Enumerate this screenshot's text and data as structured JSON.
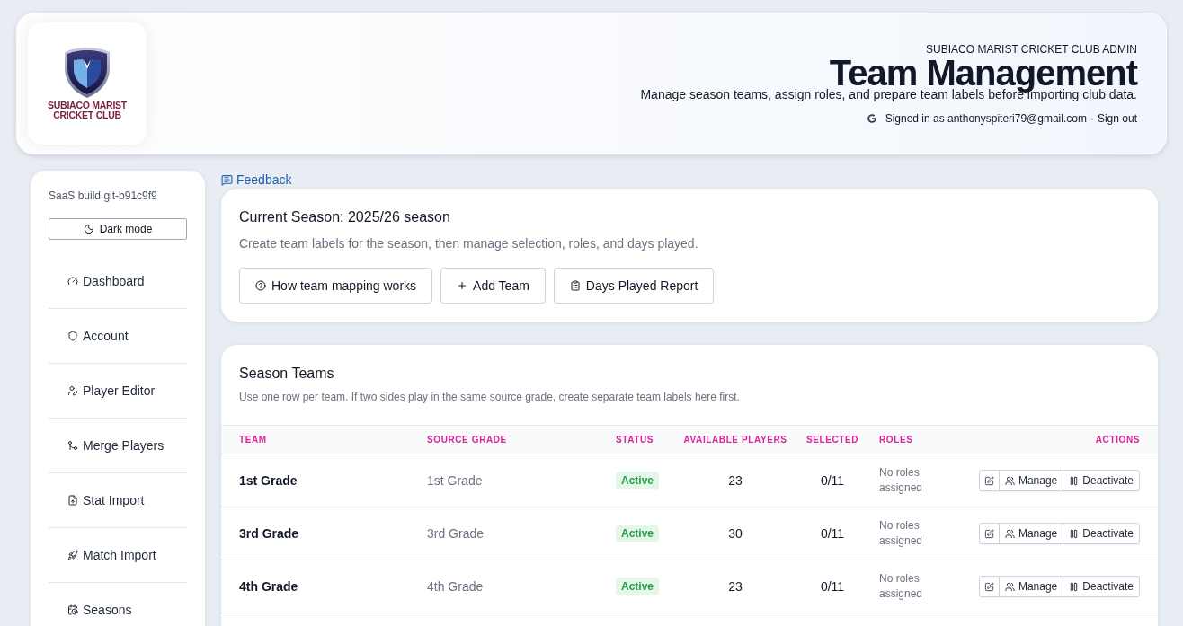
{
  "header": {
    "logo": {
      "lines": [
        "SUBIACO MARIST",
        "CRICKET CLUB"
      ]
    },
    "eyebrow": "SUBIACO MARIST CRICKET CLUB ADMIN",
    "title": "Team Management",
    "subtitle": "Manage season teams, assign roles, and prepare team labels before importing club data.",
    "account": {
      "signed_in": "Signed in as anthonyspiteri79@gmail.com",
      "separator": "·",
      "sign_out": "Sign out"
    }
  },
  "sidebar": {
    "build": "SaaS build git-b91c9f9",
    "theme_toggle": {
      "label": "Dark mode"
    },
    "items": [
      {
        "label": "Dashboard"
      },
      {
        "label": "Account"
      },
      {
        "label": "Player Editor"
      },
      {
        "label": "Merge Players"
      },
      {
        "label": "Stat Import"
      },
      {
        "label": "Match Import"
      },
      {
        "label": "Seasons"
      }
    ]
  },
  "feedback_link": {
    "label": "Feedback"
  },
  "season_card": {
    "title": "Current Season: 2025/26 season",
    "description": "Create team labels for the season, then manage selection, roles, and days played.",
    "buttons": [
      {
        "label": "How team mapping works"
      },
      {
        "label": "Add Team"
      },
      {
        "label": "Days Played Report"
      }
    ]
  },
  "teams_card": {
    "title": "Season Teams",
    "description": "Use one row per team. If two sides play in the same source grade, create separate team labels here first.",
    "columns": [
      "TEAM",
      "SOURCE GRADE",
      "STATUS",
      "AVAILABLE PLAYERS",
      "SELECTED",
      "ROLES",
      "ACTIONS"
    ],
    "rows": [
      {
        "team": "1st Grade",
        "source_grade": "1st Grade",
        "status": "Active",
        "available_players": "23",
        "selected": "0/11",
        "roles": "No roles assigned",
        "actions": [
          "Manage",
          "Deactivate"
        ]
      },
      {
        "team": "3rd Grade",
        "source_grade": "3rd Grade",
        "status": "Active",
        "available_players": "30",
        "selected": "0/11",
        "roles": "No roles assigned",
        "actions": [
          "Manage",
          "Deactivate"
        ]
      },
      {
        "team": "4th Grade",
        "source_grade": "4th Grade",
        "status": "Active",
        "available_players": "23",
        "selected": "0/11",
        "roles": "No roles assigned",
        "actions": [
          "Manage",
          "Deactivate"
        ]
      }
    ]
  }
}
